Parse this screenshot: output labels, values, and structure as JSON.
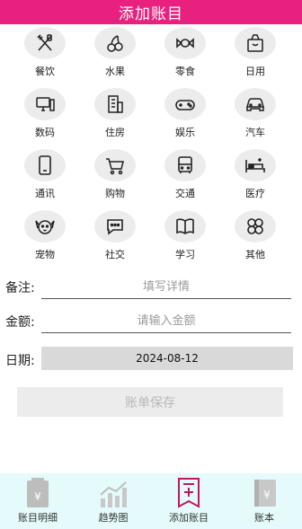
{
  "app": {
    "title": "添加账目",
    "accent": "#e8217f"
  },
  "categories": [
    {
      "label": "餐饮",
      "icon": "utensils-icon"
    },
    {
      "label": "水果",
      "icon": "cherry-icon"
    },
    {
      "label": "零食",
      "icon": "candy-icon"
    },
    {
      "label": "日用",
      "icon": "shopping-bag-icon"
    },
    {
      "label": "数码",
      "icon": "computer-icon"
    },
    {
      "label": "住房",
      "icon": "building-icon"
    },
    {
      "label": "娱乐",
      "icon": "gamepad-icon"
    },
    {
      "label": "汽车",
      "icon": "car-icon"
    },
    {
      "label": "通讯",
      "icon": "phone-icon"
    },
    {
      "label": "购物",
      "icon": "cart-icon"
    },
    {
      "label": "交通",
      "icon": "bus-icon"
    },
    {
      "label": "医疗",
      "icon": "hospital-bed-icon"
    },
    {
      "label": "宠物",
      "icon": "dog-icon"
    },
    {
      "label": "社交",
      "icon": "chat-icon"
    },
    {
      "label": "学习",
      "icon": "book-icon"
    },
    {
      "label": "其他",
      "icon": "clover-icon"
    }
  ],
  "form": {
    "note_label": "备注:",
    "note_placeholder": "填写详情",
    "amount_label": "金额:",
    "amount_placeholder": "请输入金额",
    "date_label": "日期:",
    "date_value": "2024-08-12",
    "save_label": "账单保存"
  },
  "bottom_nav": {
    "items": [
      {
        "label": "账目明细",
        "icon": "ledger-icon",
        "active": false
      },
      {
        "label": "趋势图",
        "icon": "trend-chart-icon",
        "active": false
      },
      {
        "label": "添加账目",
        "icon": "add-bill-icon",
        "active": true
      },
      {
        "label": "账本",
        "icon": "account-book-icon",
        "active": false
      }
    ]
  }
}
